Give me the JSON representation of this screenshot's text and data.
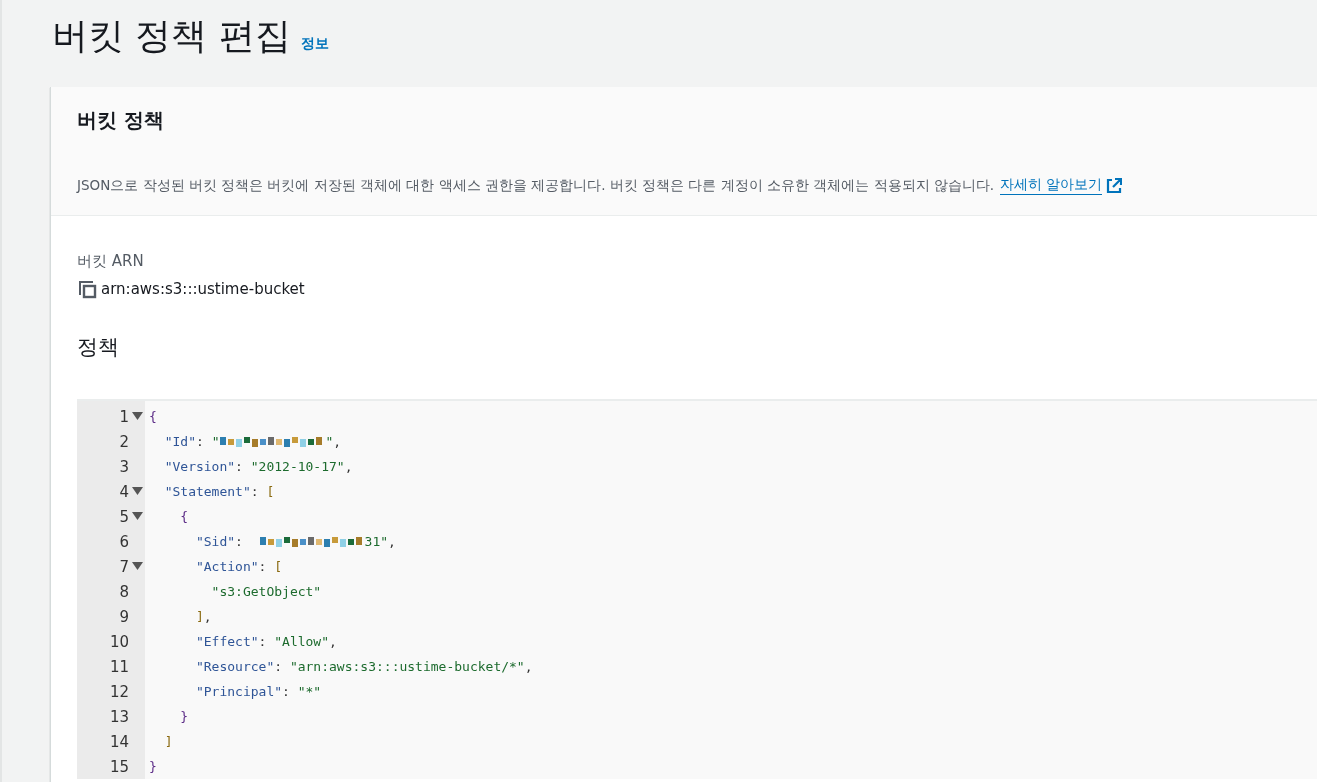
{
  "page": {
    "title": "버킷 정책 편집",
    "info_link": "정보"
  },
  "panel": {
    "title": "버킷 정책",
    "description": "JSON으로 작성된 버킷 정책은 버킷에 저장된 객체에 대한 액세스 권한을 제공합니다. 버킷 정책은 다른 계정이 소유한 객체에는 적용되지 않습니다.",
    "learn_more": "자세히 알아보기",
    "arn_label": "버킷 ARN",
    "arn_value": "arn:aws:s3:::ustime-bucket",
    "policy_label": "정책",
    "editor": {
      "lines": [
        {
          "number": "1",
          "kind": "fold",
          "expanded": true,
          "tokens": [
            {
              "kind": "brace",
              "text": "{"
            }
          ]
        },
        {
          "number": "2",
          "kind": "plain",
          "tokens": [
            {
              "kind": "key",
              "text": "  \"Id\""
            },
            {
              "kind": "punct",
              "text": ": "
            },
            {
              "kind": "string",
              "text": "\""
            },
            {
              "kind": "redacted"
            },
            {
              "kind": "string",
              "text": "\""
            },
            {
              "kind": "punct",
              "text": ","
            }
          ]
        },
        {
          "number": "3",
          "kind": "plain",
          "tokens": [
            {
              "kind": "key",
              "text": "  \"Version\""
            },
            {
              "kind": "punct",
              "text": ": "
            },
            {
              "kind": "string",
              "text": "\"2012-10-17\""
            },
            {
              "kind": "punct",
              "text": ","
            }
          ]
        },
        {
          "number": "4",
          "kind": "fold",
          "expanded": true,
          "tokens": [
            {
              "kind": "key",
              "text": "  \"Statement\""
            },
            {
              "kind": "punct",
              "text": ": "
            },
            {
              "kind": "bracket",
              "text": "["
            }
          ]
        },
        {
          "number": "5",
          "kind": "fold",
          "expanded": true,
          "tokens": [
            {
              "kind": "brace",
              "text": "    {"
            }
          ]
        },
        {
          "number": "6",
          "kind": "plain",
          "tokens": [
            {
              "kind": "key",
              "text": "      \"Sid\""
            },
            {
              "kind": "punct",
              "text": ":  "
            },
            {
              "kind": "redacted"
            },
            {
              "kind": "string",
              "text": "31\""
            },
            {
              "kind": "punct",
              "text": ","
            }
          ]
        },
        {
          "number": "7",
          "kind": "fold",
          "expanded": true,
          "tokens": [
            {
              "kind": "key",
              "text": "      \"Action\""
            },
            {
              "kind": "punct",
              "text": ": "
            },
            {
              "kind": "bracket",
              "text": "["
            }
          ]
        },
        {
          "number": "8",
          "kind": "plain",
          "tokens": [
            {
              "kind": "string",
              "text": "        \"s3:GetObject\""
            }
          ]
        },
        {
          "number": "9",
          "kind": "plain",
          "tokens": [
            {
              "kind": "bracket",
              "text": "      ]"
            },
            {
              "kind": "punct",
              "text": ","
            }
          ]
        },
        {
          "number": "10",
          "kind": "plain",
          "tokens": [
            {
              "kind": "key",
              "text": "      \"Effect\""
            },
            {
              "kind": "punct",
              "text": ": "
            },
            {
              "kind": "string",
              "text": "\"Allow\""
            },
            {
              "kind": "punct",
              "text": ","
            }
          ]
        },
        {
          "number": "11",
          "kind": "plain",
          "tokens": [
            {
              "kind": "key",
              "text": "      \"Resource\""
            },
            {
              "kind": "punct",
              "text": ": "
            },
            {
              "kind": "string",
              "text": "\"arn:aws:s3:::ustime-bucket/*\""
            },
            {
              "kind": "punct",
              "text": ","
            }
          ]
        },
        {
          "number": "12",
          "kind": "plain",
          "tokens": [
            {
              "kind": "key",
              "text": "      \"Principal\""
            },
            {
              "kind": "punct",
              "text": ": "
            },
            {
              "kind": "string",
              "text": "\"*\""
            }
          ]
        },
        {
          "number": "13",
          "kind": "plain",
          "tokens": [
            {
              "kind": "brace",
              "text": "    }"
            }
          ]
        },
        {
          "number": "14",
          "kind": "plain",
          "tokens": [
            {
              "kind": "bracket",
              "text": "  ]"
            }
          ]
        },
        {
          "number": "15",
          "kind": "plain",
          "tokens": [
            {
              "kind": "brace",
              "text": "}"
            }
          ]
        }
      ]
    }
  }
}
